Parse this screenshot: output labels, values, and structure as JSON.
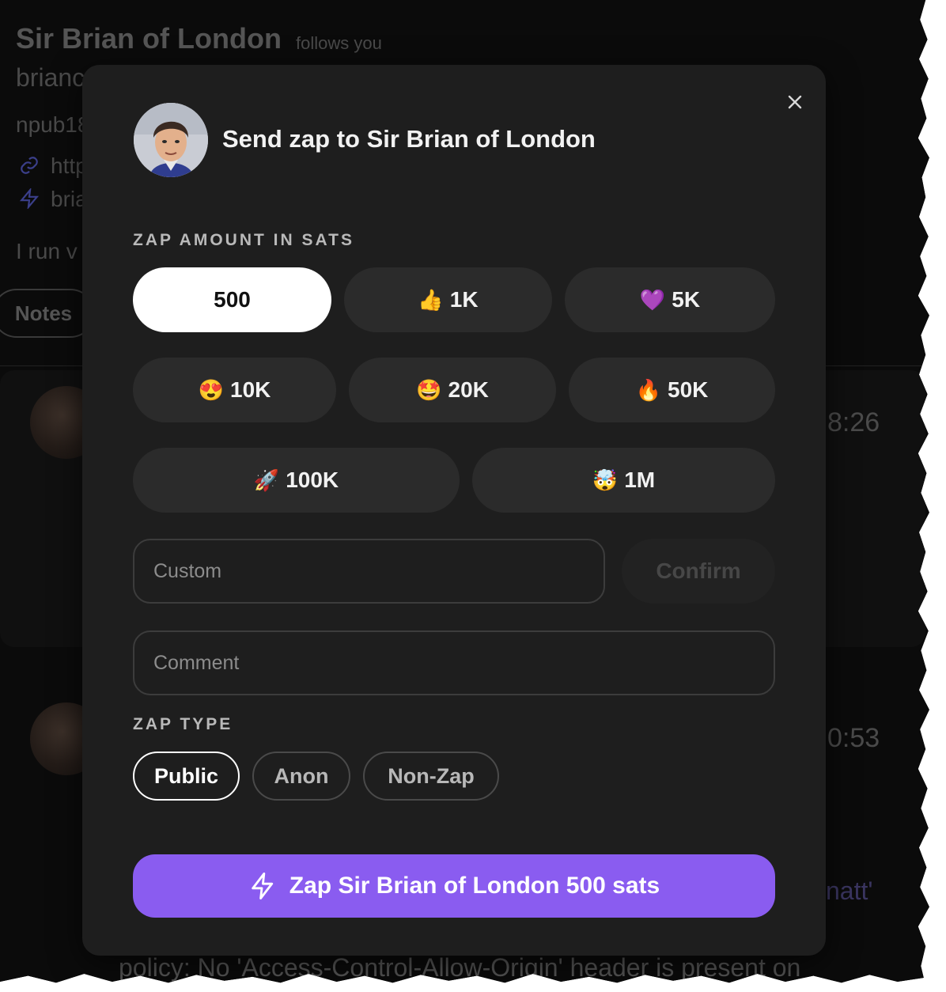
{
  "background": {
    "profile_name": "Sir Brian of London",
    "follows_you": "follows you",
    "nip05_partial": "brianc",
    "npub_partial": "npub18",
    "website_partial": "http",
    "lightning_partial": "bria",
    "about_partial": "I run v",
    "tab_notes": "Notes",
    "note_time_1": "8:26",
    "note_time_2": "0:53",
    "text_fragment_matt": "natt'",
    "policy_text": "policy: No 'Access-Control-Allow-Origin' header is present on"
  },
  "modal": {
    "title": "Send zap to Sir Brian of London",
    "amount_label": "ZAP AMOUNT IN SATS",
    "amounts": [
      {
        "emoji": "",
        "label": "500",
        "selected": true
      },
      {
        "emoji": "👍",
        "label": "1K"
      },
      {
        "emoji": "💜",
        "label": "5K"
      },
      {
        "emoji": "😍",
        "label": "10K"
      },
      {
        "emoji": "🤩",
        "label": "20K"
      },
      {
        "emoji": "🔥",
        "label": "50K"
      },
      {
        "emoji": "🚀",
        "label": "100K"
      },
      {
        "emoji": "🤯",
        "label": "1M"
      }
    ],
    "custom_placeholder": "Custom",
    "confirm_label": "Confirm",
    "comment_placeholder": "Comment",
    "zap_type_label": "ZAP TYPE",
    "zap_types": [
      "Public",
      "Anon",
      "Non-Zap"
    ],
    "selected_zap_type": "Public",
    "zap_button_label": "Zap Sir Brian of London 500 sats",
    "colors": {
      "accent": "#8a5cf0",
      "modal_bg": "#1e1e1e",
      "chip_bg": "#2b2b2b"
    }
  }
}
